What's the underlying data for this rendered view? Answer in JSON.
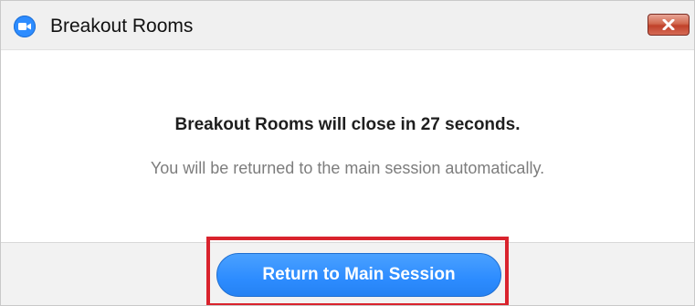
{
  "window": {
    "title": "Breakout Rooms",
    "app_icon": "zoom-camera-icon",
    "close_icon": "close-icon"
  },
  "dialog": {
    "headline": "Breakout Rooms will close in 27 seconds.",
    "message": "You will be returned to the main session automatically."
  },
  "footer": {
    "primary_button_label": "Return to Main Session"
  },
  "colors": {
    "accent": "#2d8cff",
    "highlight": "#d9232d",
    "close_button": "#c0412a"
  }
}
